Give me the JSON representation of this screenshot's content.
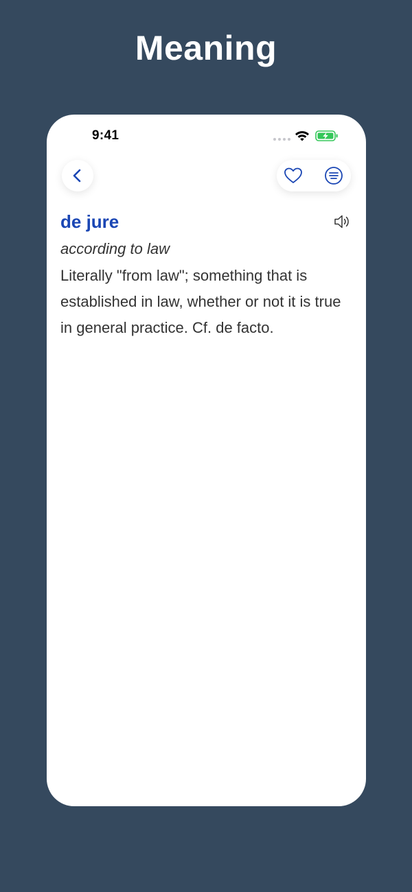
{
  "headline": "Meaning",
  "status_bar": {
    "time": "9:41"
  },
  "nav": {
    "back_icon": "chevron-left-icon",
    "favorite_icon": "heart-icon",
    "menu_icon": "list-circle-icon"
  },
  "entry": {
    "term": "de jure",
    "translation": "according to law",
    "definition": "Literally \"from law\"; something that is established in law, whether or not it is true in general practice. Cf. de facto.",
    "audio_icon": "speaker-icon"
  },
  "colors": {
    "background": "#35495e",
    "accent": "#1a46b4",
    "text": "#333333",
    "battery": "#34c759"
  }
}
